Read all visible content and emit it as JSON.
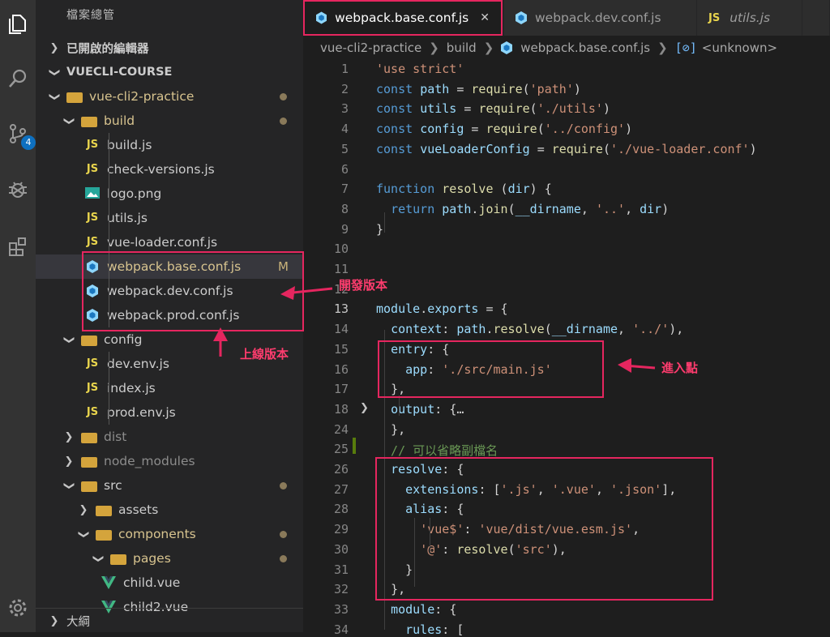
{
  "activity_bar": {
    "icons": [
      "files-icon",
      "search-icon",
      "source-control-icon",
      "debug-icon",
      "extensions-icon",
      "settings-gear-icon"
    ],
    "scm_badge": "4"
  },
  "explorer": {
    "title": "檔案總管",
    "open_editors": "已開啟的編輯器",
    "workspace": "VUECLI-COURSE",
    "outline": "大綱",
    "items": [
      {
        "label": "vue-cli2-practice",
        "type": "folder",
        "expanded": true
      },
      {
        "label": "build",
        "type": "folder",
        "expanded": true
      },
      {
        "label": "build.js",
        "type": "js"
      },
      {
        "label": "check-versions.js",
        "type": "js"
      },
      {
        "label": "logo.png",
        "type": "image"
      },
      {
        "label": "utils.js",
        "type": "js"
      },
      {
        "label": "vue-loader.conf.js",
        "type": "js"
      },
      {
        "label": "webpack.base.conf.js",
        "type": "webpack",
        "badge": "M"
      },
      {
        "label": "webpack.dev.conf.js",
        "type": "webpack"
      },
      {
        "label": "webpack.prod.conf.js",
        "type": "webpack"
      },
      {
        "label": "config",
        "type": "folder",
        "expanded": true
      },
      {
        "label": "dev.env.js",
        "type": "js"
      },
      {
        "label": "index.js",
        "type": "js"
      },
      {
        "label": "prod.env.js",
        "type": "js"
      },
      {
        "label": "dist",
        "type": "folder",
        "expanded": false
      },
      {
        "label": "node_modules",
        "type": "folder",
        "expanded": false
      },
      {
        "label": "src",
        "type": "folder",
        "expanded": true
      },
      {
        "label": "assets",
        "type": "folder",
        "expanded": false
      },
      {
        "label": "components",
        "type": "folder",
        "expanded": true
      },
      {
        "label": "pages",
        "type": "folder",
        "expanded": true
      },
      {
        "label": "child.vue",
        "type": "vue"
      },
      {
        "label": "child2.vue",
        "type": "vue"
      }
    ]
  },
  "tabs": [
    {
      "label": "webpack.base.conf.js",
      "active": true,
      "close": "✕"
    },
    {
      "label": "webpack.dev.conf.js",
      "active": false
    },
    {
      "label": "utils.js",
      "active": false,
      "prefix": "JS"
    }
  ],
  "breadcrumb": [
    "vue-cli2-practice",
    "build",
    "webpack.base.conf.js",
    "<unknown>"
  ],
  "code_lines": [
    {
      "n": "1",
      "text": "'use strict'"
    },
    {
      "n": "2",
      "text": "const path = require('path')"
    },
    {
      "n": "3",
      "text": "const utils = require('./utils')"
    },
    {
      "n": "4",
      "text": "const config = require('../config')"
    },
    {
      "n": "5",
      "text": "const vueLoaderConfig = require('./vue-loader.conf')"
    },
    {
      "n": "6",
      "text": ""
    },
    {
      "n": "7",
      "text": "function resolve (dir) {"
    },
    {
      "n": "8",
      "text": "  return path.join(__dirname, '..', dir)"
    },
    {
      "n": "9",
      "text": "}"
    },
    {
      "n": "10",
      "text": ""
    },
    {
      "n": "11",
      "text": ""
    },
    {
      "n": "12",
      "text": ""
    },
    {
      "n": "13",
      "text": "module.exports = {"
    },
    {
      "n": "14",
      "text": "  context: path.resolve(__dirname, '../'),"
    },
    {
      "n": "15",
      "text": "  entry: {"
    },
    {
      "n": "16",
      "text": "    app: './src/main.js'"
    },
    {
      "n": "17",
      "text": "  },"
    },
    {
      "n": "18",
      "text": "  output: {…"
    },
    {
      "n": "24",
      "text": "  },"
    },
    {
      "n": "25",
      "text": "  // 可以省略副檔名"
    },
    {
      "n": "26",
      "text": "  resolve: {"
    },
    {
      "n": "27",
      "text": "    extensions: ['.js', '.vue', '.json'],"
    },
    {
      "n": "28",
      "text": "    alias: {"
    },
    {
      "n": "29",
      "text": "      'vue$': 'vue/dist/vue.esm.js',"
    },
    {
      "n": "30",
      "text": "      '@': resolve('src'),"
    },
    {
      "n": "31",
      "text": "    }"
    },
    {
      "n": "32",
      "text": "  },"
    },
    {
      "n": "33",
      "text": "  module: {"
    },
    {
      "n": "34",
      "text": "    rules: ["
    }
  ],
  "annotations": {
    "dev": "開發版本",
    "prod": "上線版本",
    "entry": "進入點"
  },
  "colors": {
    "highlight": "#e5265f",
    "annotation_text": "#ff3c6e"
  }
}
